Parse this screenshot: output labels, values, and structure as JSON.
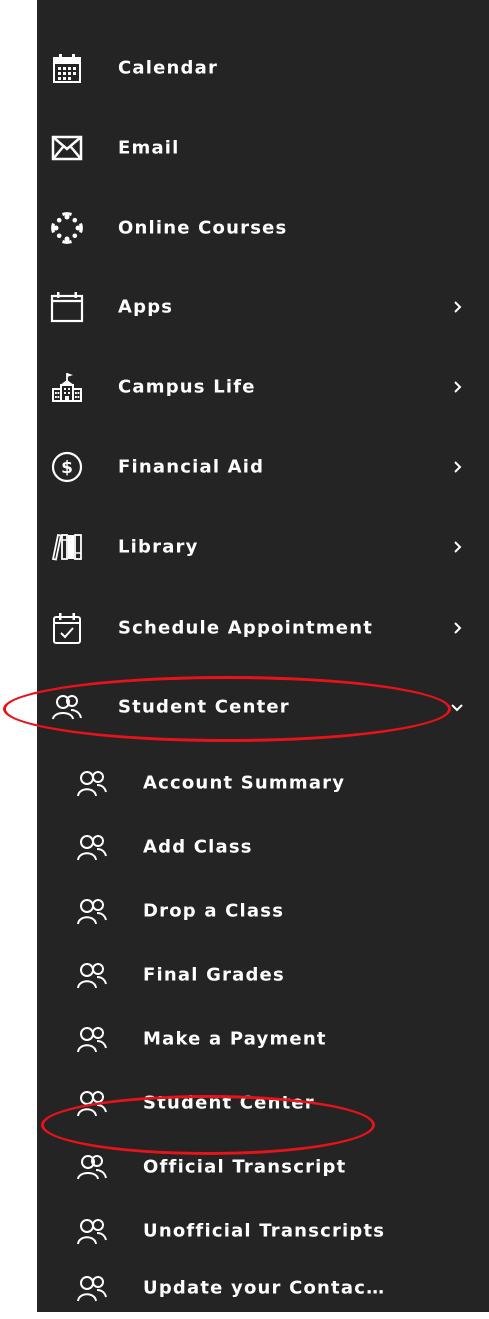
{
  "sidebar": {
    "items": [
      {
        "label": "Calendar",
        "icon": "calendar-icon"
      },
      {
        "label": "Email",
        "icon": "envelope-icon"
      },
      {
        "label": "Online Courses",
        "icon": "canvas-logo-icon"
      },
      {
        "label": "Apps",
        "icon": "window-icon",
        "has_submenu": true
      },
      {
        "label": "Campus Life",
        "icon": "school-building-icon",
        "has_submenu": true
      },
      {
        "label": "Financial Aid",
        "icon": "dollar-circle-icon",
        "has_submenu": true
      },
      {
        "label": "Library",
        "icon": "books-icon",
        "has_submenu": true
      },
      {
        "label": "Schedule Appointment",
        "icon": "calendar-check-icon",
        "has_submenu": true
      },
      {
        "label": "Student Center",
        "icon": "users-icon",
        "has_submenu": true,
        "expanded": true,
        "highlighted": true
      }
    ],
    "student_center_subitems": [
      {
        "label": "Account Summary",
        "icon": "users-icon"
      },
      {
        "label": "Add Class",
        "icon": "users-icon"
      },
      {
        "label": "Drop a Class",
        "icon": "users-icon"
      },
      {
        "label": "Final Grades",
        "icon": "users-icon"
      },
      {
        "label": "Make a Payment",
        "icon": "users-icon"
      },
      {
        "label": "Student Center",
        "icon": "users-icon",
        "highlighted": true
      },
      {
        "label": "Official Transcript",
        "icon": "users-icon"
      },
      {
        "label": "Unofficial Transcripts",
        "icon": "users-icon"
      },
      {
        "label": "Update your Contac…",
        "icon": "users-icon"
      }
    ]
  },
  "colors": {
    "sidebar_bg": "#242424",
    "text": "#ffffff",
    "highlight_annotation": "#e8121b"
  }
}
